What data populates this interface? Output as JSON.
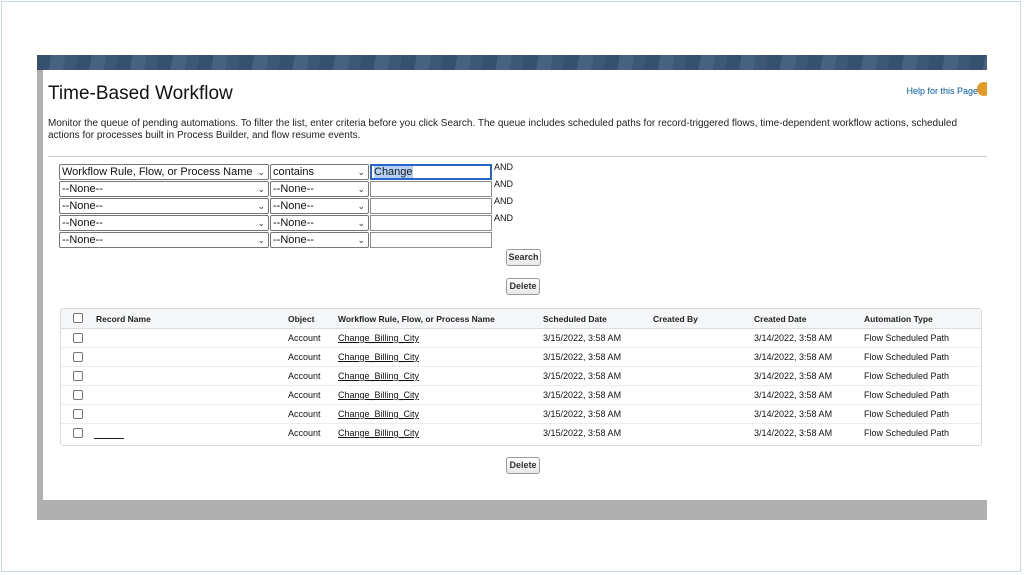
{
  "header": {
    "title": "Time-Based Workflow",
    "help_link": "Help for this Page"
  },
  "description": "Monitor the queue of pending automations. To filter the list, enter criteria before you click Search. The queue includes scheduled paths for record-triggered flows, time-dependent workflow actions, scheduled actions for processes built in Process Builder, and flow resume events.",
  "filters": [
    {
      "field": "Workflow Rule, Flow, or Process Name",
      "operator": "contains",
      "value": "Change",
      "conjunction": "AND"
    },
    {
      "field": "--None--",
      "operator": "--None--",
      "value": "",
      "conjunction": "AND"
    },
    {
      "field": "--None--",
      "operator": "--None--",
      "value": "",
      "conjunction": "AND"
    },
    {
      "field": "--None--",
      "operator": "--None--",
      "value": "",
      "conjunction": "AND"
    },
    {
      "field": "--None--",
      "operator": "--None--",
      "value": "",
      "conjunction": ""
    }
  ],
  "buttons": {
    "search": "Search",
    "delete_top": "Delete",
    "delete_bottom": "Delete"
  },
  "table": {
    "columns": [
      "Record Name",
      "Object",
      "Workflow Rule, Flow, or Process Name",
      "Scheduled Date",
      "Created By",
      "Created Date",
      "Automation Type"
    ],
    "rows": [
      {
        "record_name": "",
        "object": "Account",
        "workflow": "Change_Billing_City",
        "scheduled": "3/15/2022, 3:58 AM",
        "created_by": "",
        "created_date": "3/14/2022, 3:58 AM",
        "type": "Flow Scheduled Path"
      },
      {
        "record_name": "",
        "object": "Account",
        "workflow": "Change_Billing_City",
        "scheduled": "3/15/2022, 3:58 AM",
        "created_by": "",
        "created_date": "3/14/2022, 3:58 AM",
        "type": "Flow Scheduled Path"
      },
      {
        "record_name": "",
        "object": "Account",
        "workflow": "Change_Billing_City",
        "scheduled": "3/15/2022, 3:58 AM",
        "created_by": "",
        "created_date": "3/14/2022, 3:58 AM",
        "type": "Flow Scheduled Path"
      },
      {
        "record_name": "",
        "object": "Account",
        "workflow": "Change_Billing_City",
        "scheduled": "3/15/2022, 3:58 AM",
        "created_by": "",
        "created_date": "3/14/2022, 3:58 AM",
        "type": "Flow Scheduled Path"
      },
      {
        "record_name": "",
        "object": "Account",
        "workflow": "Change_Billing_City",
        "scheduled": "3/15/2022, 3:58 AM",
        "created_by": "",
        "created_date": "3/14/2022, 3:58 AM",
        "type": "Flow Scheduled Path"
      },
      {
        "record_name": "",
        "object": "Account",
        "workflow": "Change_Billing_City",
        "scheduled": "3/15/2022, 3:58 AM",
        "created_by": "",
        "created_date": "3/14/2022, 3:58 AM",
        "type": "Flow Scheduled Path"
      }
    ]
  },
  "colors": {
    "banner": "#36516d",
    "link": "#015ba7",
    "focus": "#2a64c5",
    "help_icon": "#e59a24"
  }
}
